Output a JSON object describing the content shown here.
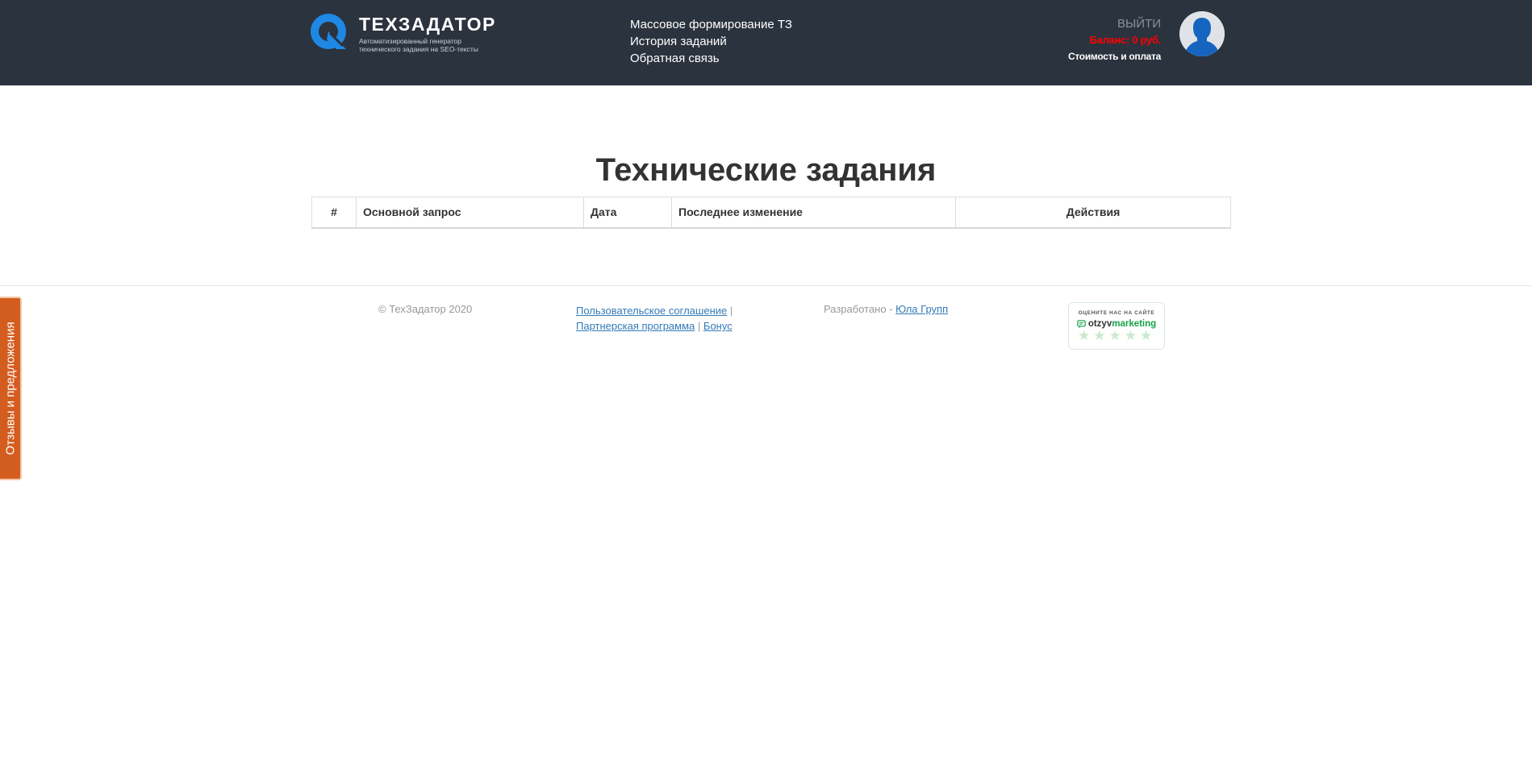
{
  "header": {
    "logo_title": "ТЕХЗАДАТОР",
    "logo_subtitle": "Автоматизированный генератор технического задания на SEO-тексты",
    "nav": [
      {
        "label": "Массовое формирование ТЗ"
      },
      {
        "label": "История заданий"
      },
      {
        "label": "Обратная связь"
      }
    ],
    "logout_label": "ВЫЙТИ",
    "balance_label": "Баланс: 0 руб.",
    "pricing_label": "Стоимость и оплата"
  },
  "main": {
    "title": "Технические задания",
    "table": {
      "columns": [
        "#",
        "Основной запрос",
        "Дата",
        "Последнее изменение",
        "Действия"
      ],
      "rows": []
    }
  },
  "footer": {
    "copyright": "© ТехЗадатор 2020",
    "agreement_link": "Пользовательское соглашение",
    "separator": "|",
    "partner_link": "Партнерская программа",
    "bonus_link": "Бонус",
    "developed_prefix": "Разработано -",
    "developer_link": "Юла Групп",
    "rating_widget": {
      "top_text": "ОЦЕНИТЕ НАС НА САЙТЕ",
      "brand_part1": "otzyv",
      "brand_part2": "marketing",
      "stars": "★★★★★"
    }
  },
  "feedback_tab_label": "Отзывы и предложения",
  "colors": {
    "header_bg": "#2b333e",
    "accent_blue": "#1e88e5",
    "balance_red": "#ff0000",
    "feedback_orange": "#d35d1f",
    "link": "#337ab7"
  }
}
